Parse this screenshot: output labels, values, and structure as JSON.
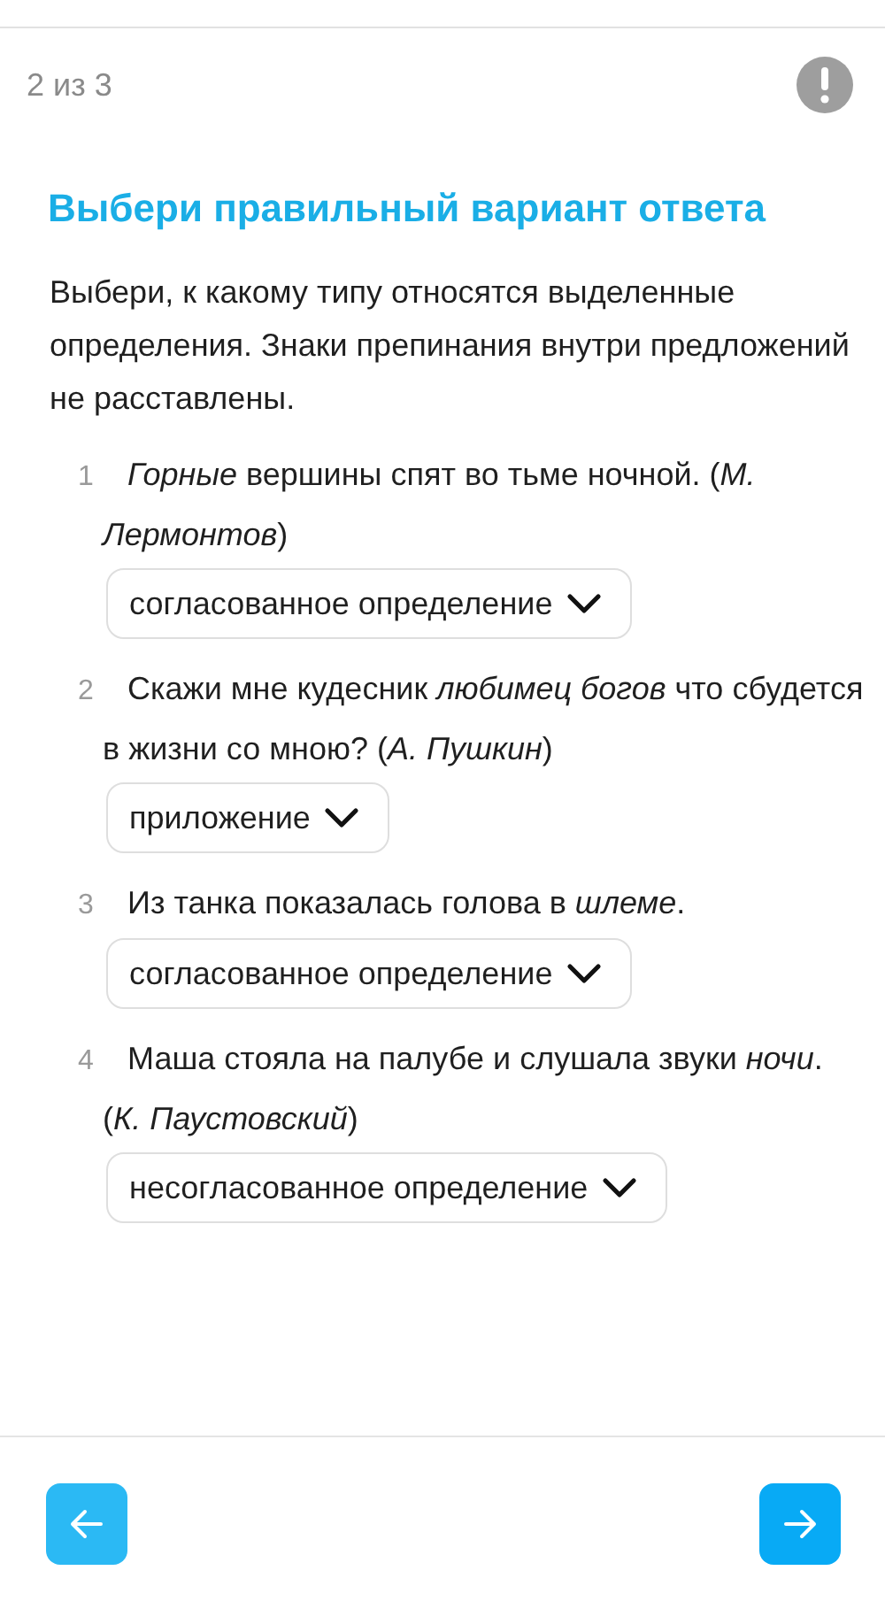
{
  "progress": "2 из 3",
  "title": "Выбери правильный вариант ответа",
  "instructions": "Выбери, к какому типу относятся выделенные определения. Знаки препинания внутри предложений не расставлены.",
  "questions": [
    {
      "number": "1",
      "text": "*Горные* вершины спят во тьме ночной. (*М. Лермонтов*)",
      "answer": "согласованное определение"
    },
    {
      "number": "2",
      "text": "Скажи мне кудесник *любимец богов* что сбудется в жизни со мною? (*А. Пушкин*)",
      "answer": "приложение"
    },
    {
      "number": "3",
      "text": "Из танка показалась голова в *шлеме*.",
      "answer": "согласованное определение"
    },
    {
      "number": "4",
      "text": "Маша стояла на палубе и слушала звуки *ночи*. (*К. Паустовский*)",
      "answer": "несогласованное определение"
    }
  ]
}
